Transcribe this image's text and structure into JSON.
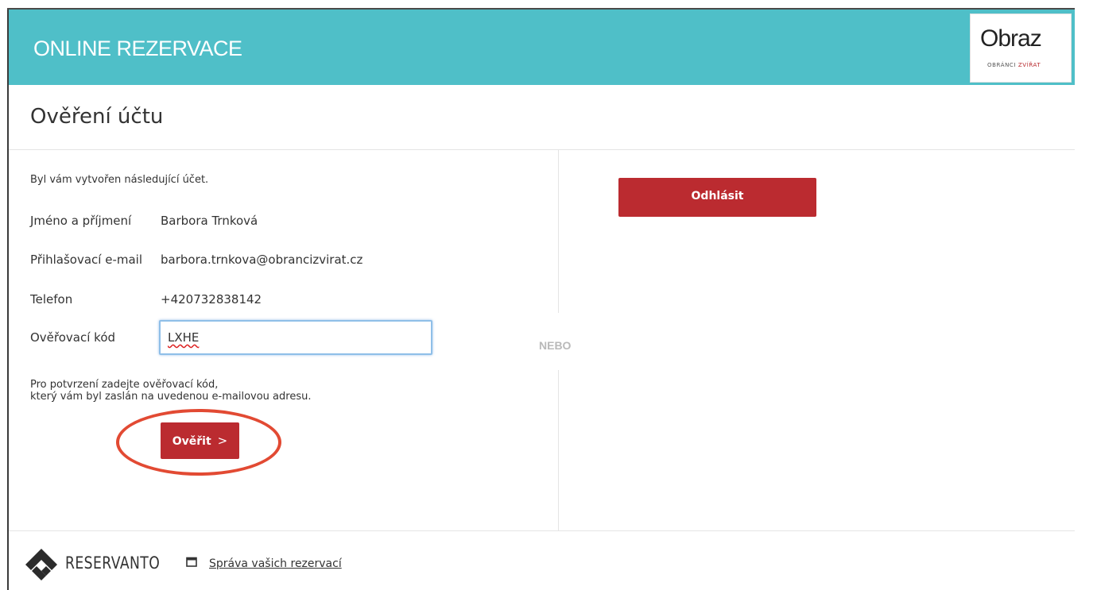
{
  "header": {
    "title": "ONLINE REZERVACE",
    "logo_word": "Obraz",
    "logo_tagline_a": "OBRÁNCI",
    "logo_tagline_b": "ZVÍŘAT"
  },
  "page": {
    "title": "Ověření účtu",
    "separator": "NEBO"
  },
  "account": {
    "intro": "Byl vám vytvořen následující účet.",
    "fields": [
      {
        "label": "Jméno a příjmení",
        "value": "Barbora Trnková"
      },
      {
        "label": "Přihlašovací e-mail",
        "value": "barbora.trnkova@obrancizvirat.cz"
      },
      {
        "label": "Telefon",
        "value": "+420732838142"
      }
    ],
    "code_label": "Ověřovací kód",
    "code_value": "LXHE",
    "help_line1": "Pro potvrzení zadejte ověřovací kód,",
    "help_line2": "který vám byl zaslán na uvedenou e-mailovou adresu.",
    "verify_label": "Ověřit",
    "verify_chevron": ">"
  },
  "right": {
    "logout_label": "Odhlásit"
  },
  "footer": {
    "brand": "RESERVANTO",
    "link": "Správa vašich rezervací"
  },
  "colors": {
    "header_bg": "#4fbfc8",
    "button_red": "#bb2b30",
    "highlight_ring": "#e24a33"
  },
  "icons": {
    "logo_mark": "reservanto-diamond-icon",
    "manage_link": "calendar-icon"
  }
}
